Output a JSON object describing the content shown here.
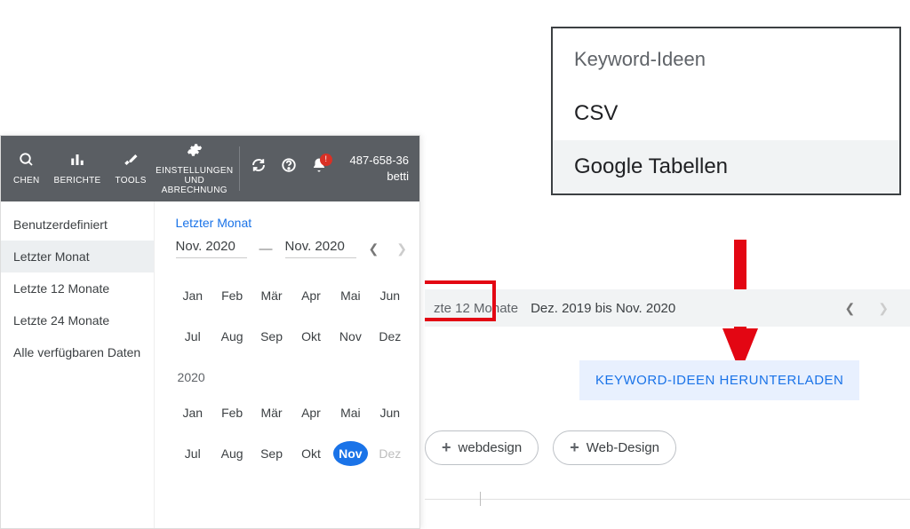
{
  "toolbar": {
    "search_label": "CHEN",
    "reports_label": "BERICHTE",
    "tools_label": "TOOLS",
    "settings_label": "EINSTELLUNGEN UND ABRECHNUNG",
    "account_id": "487-658-36",
    "account_name": "betti",
    "bell_badge": "!"
  },
  "presets": [
    {
      "label": "Benutzerdefiniert",
      "selected": false
    },
    {
      "label": "Letzter Monat",
      "selected": true
    },
    {
      "label": "Letzte 12 Monate",
      "selected": false
    },
    {
      "label": "Letzte 24 Monate",
      "selected": false
    },
    {
      "label": "Alle verfügbaren Daten",
      "selected": false
    }
  ],
  "calendar": {
    "title": "Letzter Monat",
    "from": "Nov. 2020",
    "to": "Nov. 2020",
    "dash": "—",
    "months_row1": [
      "Jan",
      "Feb",
      "Mär",
      "Apr",
      "Mai",
      "Jun"
    ],
    "months_row2": [
      "Jul",
      "Aug",
      "Sep",
      "Okt",
      "Nov",
      "Dez"
    ],
    "year2": "2020",
    "selected_month_year2": "Nov",
    "disabled_month_year2": "Dez"
  },
  "popup": {
    "heading": "Keyword-Ideen",
    "opt_csv": "CSV",
    "opt_sheets": "Google Tabellen"
  },
  "range_bar": {
    "preset": "zte 12 Monate",
    "range": "Dez. 2019 bis Nov. 2020"
  },
  "download_button": "KEYWORD-IDEEN HERUNTERLADEN",
  "chips": {
    "c1": "webdesign",
    "c2": "Web-Design"
  }
}
